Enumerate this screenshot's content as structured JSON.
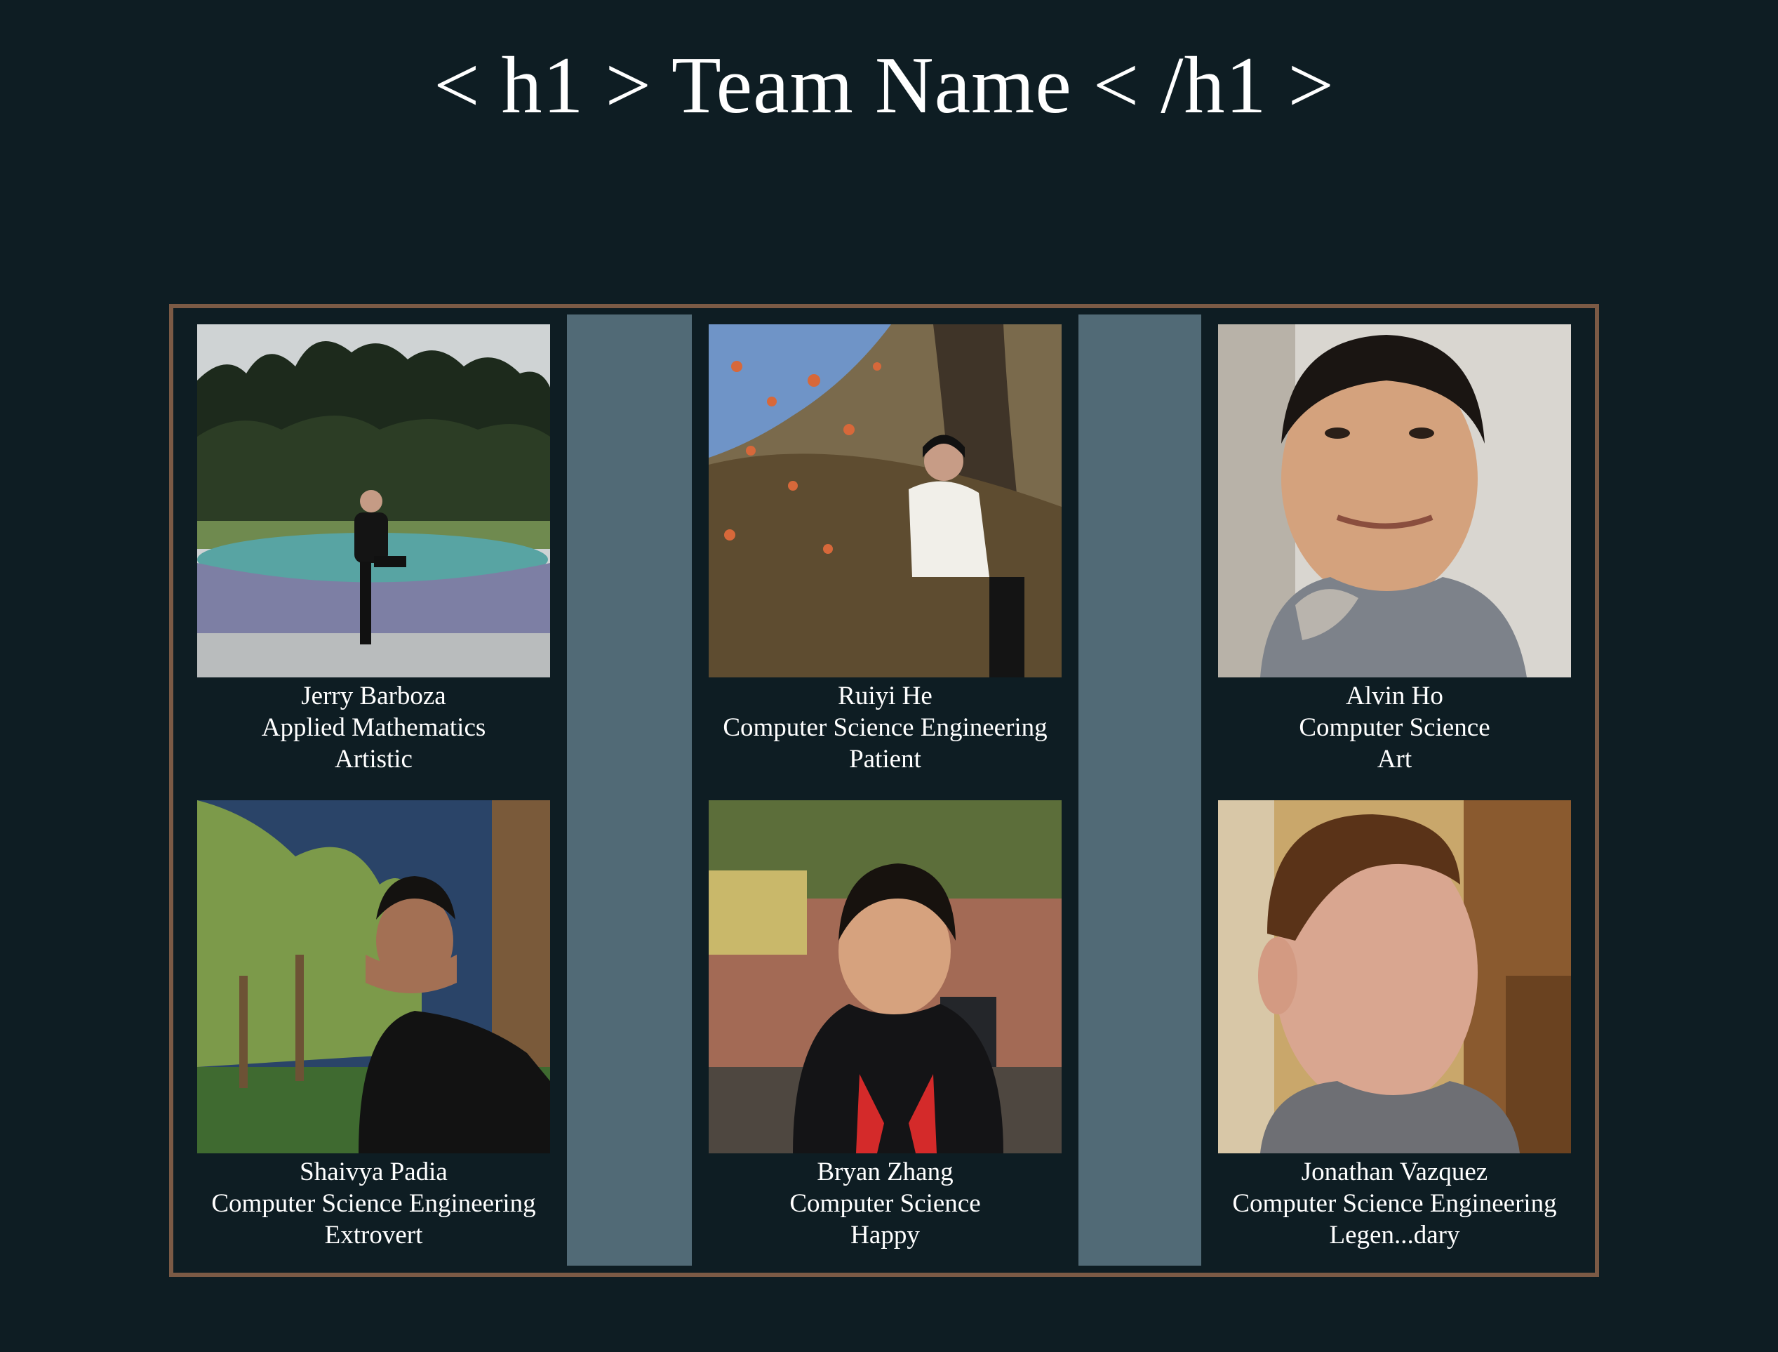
{
  "page": {
    "title": "< h1 > Team Name < /h1 >"
  },
  "colors": {
    "background": "#0e1d23",
    "frame_border": "#7b5a45",
    "gutter": "#516a76",
    "text": "#ffffff"
  },
  "team": {
    "members": [
      {
        "name": "Jerry Barboza",
        "major": "Applied Mathematics",
        "trait": "Artistic",
        "photo": "portrait-photo-fountain"
      },
      {
        "name": "Ruiyi He",
        "major": "Computer Science Engineering",
        "trait": "Patient",
        "photo": "portrait-photo-autumn-tree"
      },
      {
        "name": "Alvin Ho",
        "major": "Computer Science",
        "trait": "Art",
        "photo": "portrait-photo-selfie-car"
      },
      {
        "name": "Shaivya Padia",
        "major": "Computer Science Engineering",
        "trait": "Extrovert",
        "photo": "portrait-photo-garden-night"
      },
      {
        "name": "Bryan Zhang",
        "major": "Computer Science",
        "trait": "Happy",
        "photo": "portrait-photo-hoodie-outdoor"
      },
      {
        "name": "Jonathan Vazquez",
        "major": "Computer Science Engineering",
        "trait": "Legen...dary",
        "photo": "portrait-photo-selfie-room"
      }
    ]
  }
}
